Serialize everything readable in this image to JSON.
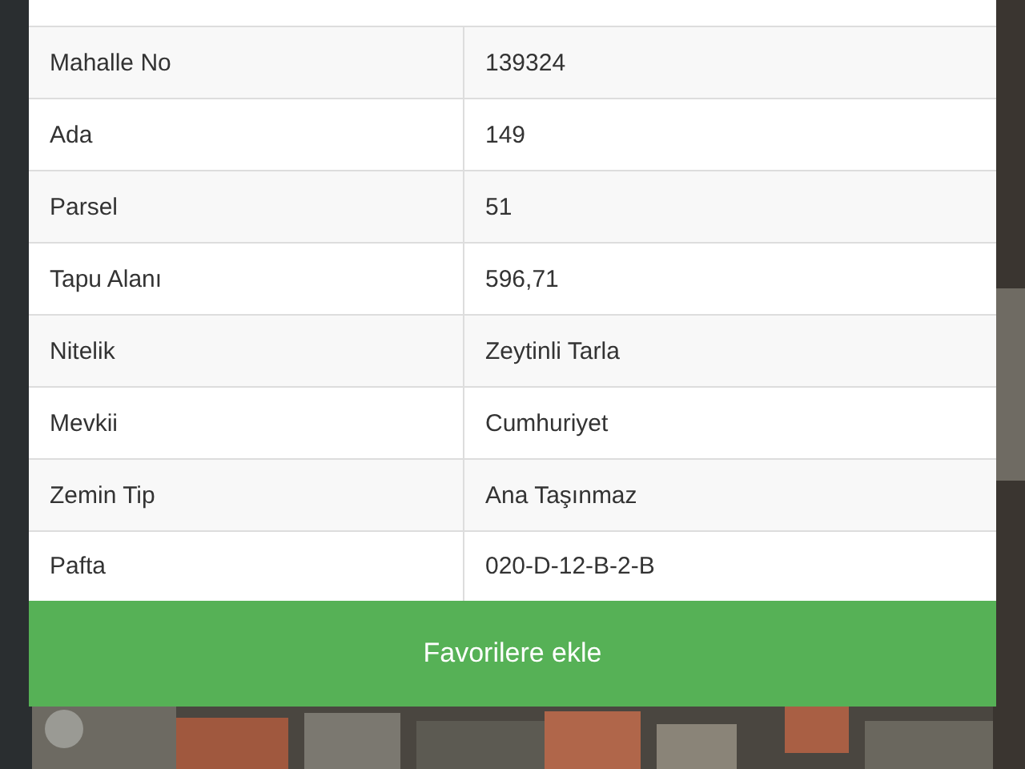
{
  "rows": [
    {
      "label": "Mahalle No",
      "value": "139324"
    },
    {
      "label": "Ada",
      "value": "149"
    },
    {
      "label": "Parsel",
      "value": "51"
    },
    {
      "label": "Tapu Alanı",
      "value": "596,71"
    },
    {
      "label": "Nitelik",
      "value": "Zeytinli Tarla"
    },
    {
      "label": "Mevkii",
      "value": "Cumhuriyet"
    },
    {
      "label": "Zemin Tip",
      "value": "Ana Taşınmaz"
    },
    {
      "label": "Pafta",
      "value": "020-D-12-B-2-B"
    }
  ],
  "button": {
    "label": "Favorilere ekle"
  }
}
